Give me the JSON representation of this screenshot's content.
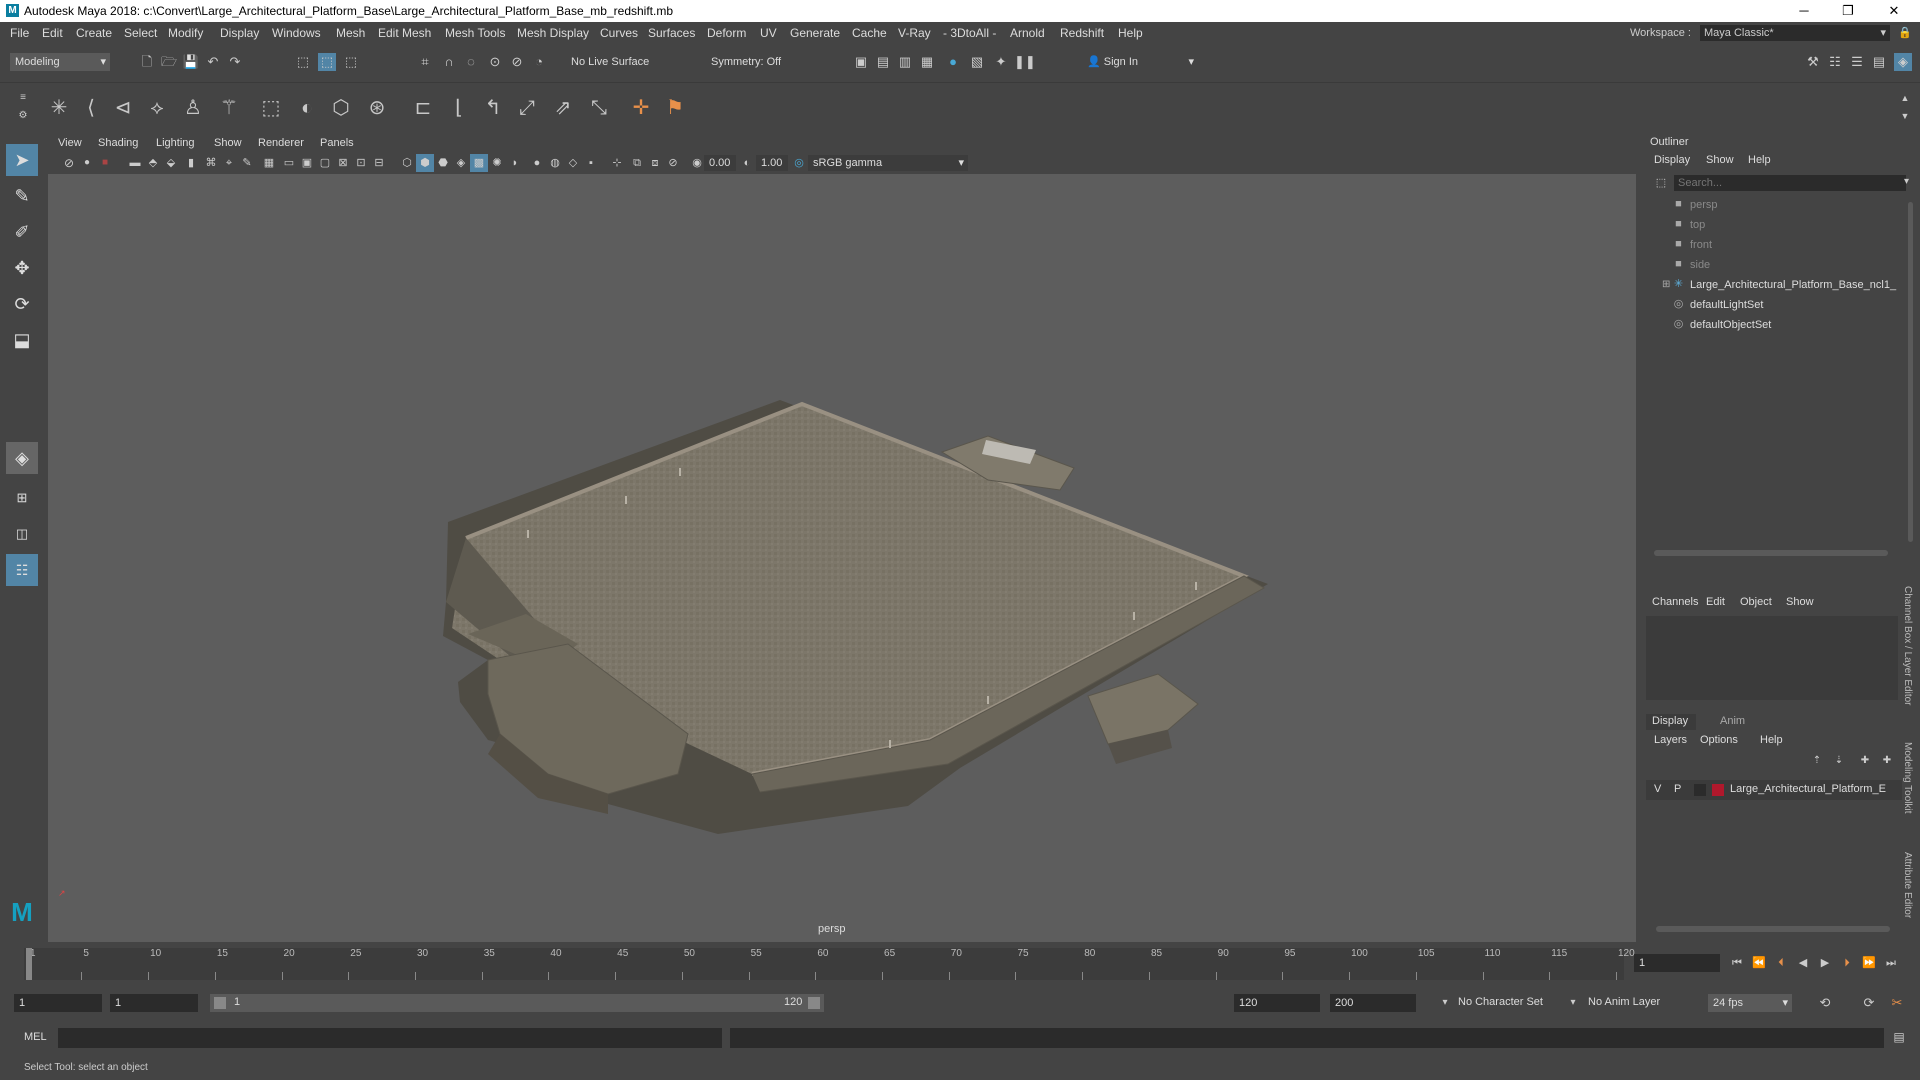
{
  "window": {
    "title": "Autodesk Maya 2018: c:\\Convert\\Large_Architectural_Platform_Base\\Large_Architectural_Platform_Base_mb_redshift.mb",
    "logo": "M",
    "minimize_icon": "─",
    "maximize_icon": "❐",
    "close_icon": "✕"
  },
  "menubar": {
    "items": [
      "File",
      "Edit",
      "Create",
      "Select",
      "Modify",
      "Display",
      "Windows",
      "Mesh",
      "Edit Mesh",
      "Mesh Tools",
      "Mesh Display",
      "Curves",
      "Surfaces",
      "Deform",
      "UV",
      "Generate",
      "Cache",
      "V-Ray",
      "- 3DtoAll -",
      "Arnold",
      "Redshift",
      "Help"
    ],
    "workspace_label": "Workspace :",
    "workspace_value": "Maya Classic*"
  },
  "statusline": {
    "mode": "Modeling",
    "live_surface": "No Live Surface",
    "symmetry": "Symmetry: Off",
    "sign_in": "Sign In"
  },
  "panel": {
    "menus": [
      "View",
      "Shading",
      "Lighting",
      "Show",
      "Renderer",
      "Panels"
    ],
    "exposure": "0.00",
    "gamma": "1.00",
    "color_space": "sRGB gamma",
    "camera": "persp"
  },
  "outliner": {
    "title": "Outliner",
    "menus": [
      "Display",
      "Show",
      "Help"
    ],
    "search_placeholder": "Search...",
    "items": [
      {
        "label": "persp",
        "dim": true,
        "icon": "camera-icon"
      },
      {
        "label": "top",
        "dim": true,
        "icon": "camera-icon"
      },
      {
        "label": "front",
        "dim": true,
        "icon": "camera-icon"
      },
      {
        "label": "side",
        "dim": true,
        "icon": "camera-icon"
      },
      {
        "label": "Large_Architectural_Platform_Base_ncl1_",
        "dim": false,
        "icon": "transform-icon"
      },
      {
        "label": "defaultLightSet",
        "dim": false,
        "icon": "set-icon"
      },
      {
        "label": "defaultObjectSet",
        "dim": false,
        "icon": "set-icon"
      }
    ]
  },
  "channelbox": {
    "menus": [
      "Channels",
      "Edit",
      "Object",
      "Show"
    ]
  },
  "layereditor": {
    "tabs": [
      "Display",
      "Anim"
    ],
    "menus": [
      "Layers",
      "Options",
      "Help"
    ],
    "layer": {
      "v": "V",
      "p": "P",
      "name": "Large_Architectural_Platform_E",
      "color": "#b0182c"
    }
  },
  "sidetabs": [
    "Channel Box / Layer Editor",
    "Modeling Toolkit",
    "Attribute Editor"
  ],
  "timeline": {
    "ticks": [
      "1",
      "5",
      "10",
      "15",
      "20",
      "25",
      "30",
      "35",
      "40",
      "45",
      "50",
      "55",
      "60",
      "65",
      "70",
      "75",
      "80",
      "85",
      "90",
      "95",
      "100",
      "105",
      "110",
      "115",
      "120"
    ],
    "current_frame": "1"
  },
  "range": {
    "start": "1",
    "playback_start": "1",
    "slider_start": "1",
    "slider_end": "120",
    "playback_end": "120",
    "end": "200",
    "character_set": "No Character Set",
    "anim_layer": "No Anim Layer",
    "fps": "24 fps"
  },
  "cmdline": {
    "label": "MEL"
  },
  "helpline": {
    "text": "Select Tool: select an object"
  }
}
